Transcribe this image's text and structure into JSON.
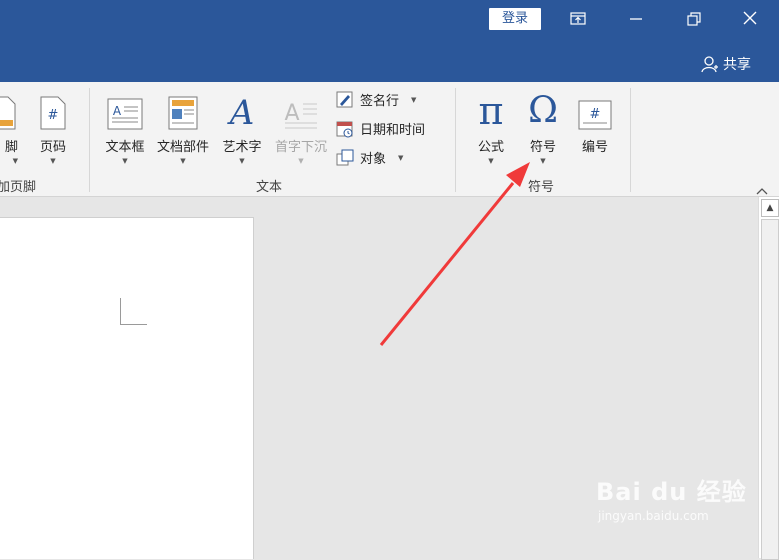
{
  "titlebar": {
    "login_label": "登录",
    "share_label": "共享"
  },
  "ribbon": {
    "partial_button_label": "脚",
    "header_footer_group_label": "加页脚",
    "page_number_label": "页码",
    "text_box_label": "文本框",
    "quick_parts_label": "文档部件",
    "wordart_label": "艺术字",
    "drop_cap_label": "首字下沉",
    "signature_line_label": "签名行",
    "date_time_label": "日期和时间",
    "object_label": "对象",
    "text_group_label": "文本",
    "equation_label": "公式",
    "symbol_label": "符号",
    "numbering_label": "编号",
    "symbols_group_label": "符号",
    "equation_glyph": "π",
    "symbol_glyph": "Ω",
    "wordart_glyph": "A",
    "drop_cap_glyph": "A",
    "page_number_glyph": "#",
    "numbering_glyph": "#"
  },
  "colors": {
    "titlebar": "#2b579a",
    "accent_icon": "#2b579a",
    "arrow": "#f03a3a"
  },
  "watermark": {
    "brand": "Bai du 经验",
    "url": "jingyan.baidu.com"
  }
}
